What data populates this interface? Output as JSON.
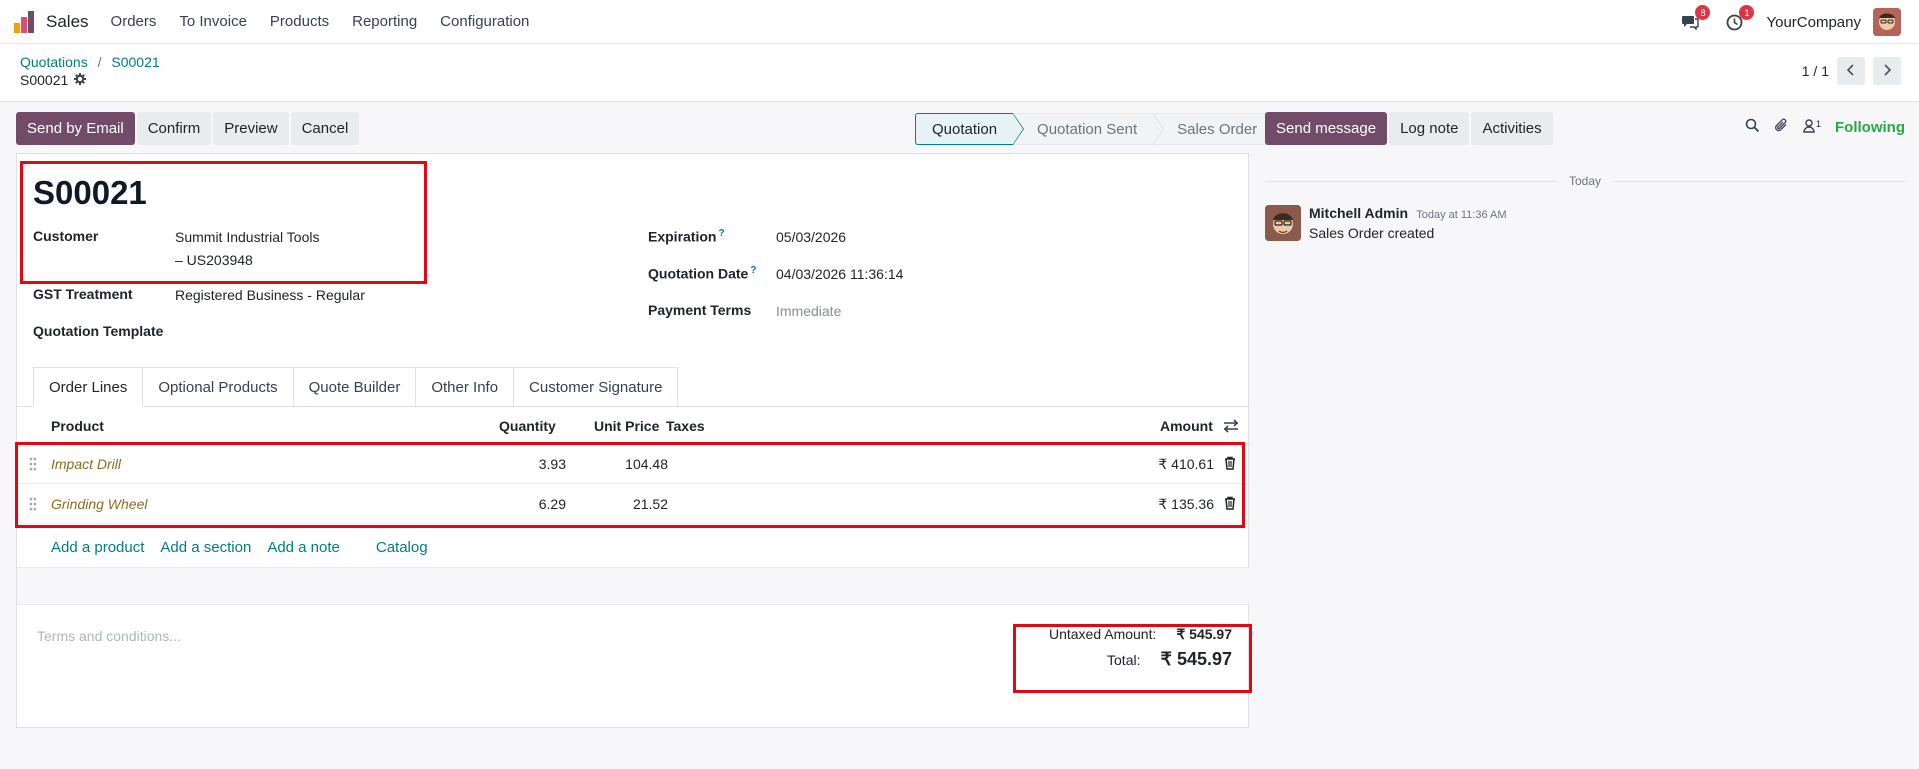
{
  "nav": {
    "app_name": "Sales",
    "menu": [
      "Orders",
      "To Invoice",
      "Products",
      "Reporting",
      "Configuration"
    ],
    "messages_badge": "8",
    "activities_badge": "1",
    "company": "YourCompany"
  },
  "breadcrumb": {
    "parent": "Quotations",
    "current": "S00021",
    "record_name": "S00021"
  },
  "pager": {
    "text": "1 / 1"
  },
  "actions": {
    "send_email": "Send by Email",
    "confirm": "Confirm",
    "preview": "Preview",
    "cancel": "Cancel"
  },
  "statusbar": [
    "Quotation",
    "Quotation Sent",
    "Sales Order"
  ],
  "form": {
    "title": "S00021",
    "customer_label": "Customer",
    "customer_name": "Summit Industrial Tools",
    "customer_ref": "– US203948",
    "gst_label": "GST Treatment",
    "gst_value": "Registered Business - Regular",
    "template_label": "Quotation Template",
    "expiration_label": "Expiration",
    "expiration_value": "05/03/2026",
    "quotation_date_label": "Quotation Date",
    "quotation_date_value": "04/03/2026 11:36:14",
    "payment_terms_label": "Payment Terms",
    "payment_terms_value": "Immediate",
    "help_mark": "?"
  },
  "tabs": [
    "Order Lines",
    "Optional Products",
    "Quote Builder",
    "Other Info",
    "Customer Signature"
  ],
  "lines": {
    "headers": {
      "product": "Product",
      "quantity": "Quantity",
      "unit_price": "Unit Price",
      "taxes": "Taxes",
      "amount": "Amount"
    },
    "rows": [
      {
        "product": "Impact Drill",
        "quantity": "3.93",
        "unit_price": "104.48",
        "amount": "₹ 410.61"
      },
      {
        "product": "Grinding Wheel",
        "quantity": "6.29",
        "unit_price": "21.52",
        "amount": "₹ 135.36"
      }
    ],
    "add_product": "Add a product",
    "add_section": "Add a section",
    "add_note": "Add a note",
    "catalog": "Catalog"
  },
  "terms_placeholder": "Terms and conditions...",
  "totals": {
    "untaxed_label": "Untaxed Amount:",
    "untaxed_value": "₹ 545.97",
    "total_label": "Total:",
    "total_value": "₹ 545.97"
  },
  "chatter": {
    "send_message": "Send message",
    "log_note": "Log note",
    "activities": "Activities",
    "followers_count": "1",
    "following": "Following",
    "date_separator": "Today",
    "message": {
      "author": "Mitchell Admin",
      "time": "Today at 11:36 AM",
      "body": "Sales Order created"
    }
  },
  "colors": {
    "brand": "#714b67",
    "link": "#017e84",
    "highlight_box": "#e30613",
    "following": "#28a745"
  }
}
